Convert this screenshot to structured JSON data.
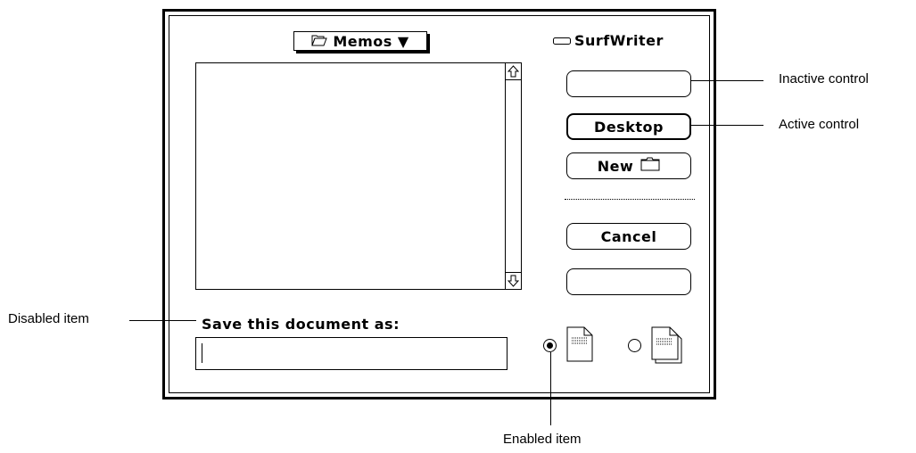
{
  "dialog": {
    "folder_popup": {
      "label": "Memos",
      "arrow": "▼",
      "icon": "open-folder-icon"
    },
    "drive": {
      "label": "SurfWriter",
      "icon": "disk-icon"
    },
    "buttons": {
      "inactive": "",
      "desktop": "Desktop",
      "new": "New",
      "cancel": "Cancel",
      "blank": ""
    },
    "save_prompt": "Save this document as:",
    "filename_value": "",
    "radio_options": [
      {
        "icon": "document-icon",
        "selected": true
      },
      {
        "icon": "stationery-icon",
        "selected": false
      }
    ]
  },
  "callouts": {
    "inactive_control": "Inactive control",
    "active_control": "Active control",
    "disabled_item": "Disabled item",
    "enabled_item": "Enabled item"
  }
}
